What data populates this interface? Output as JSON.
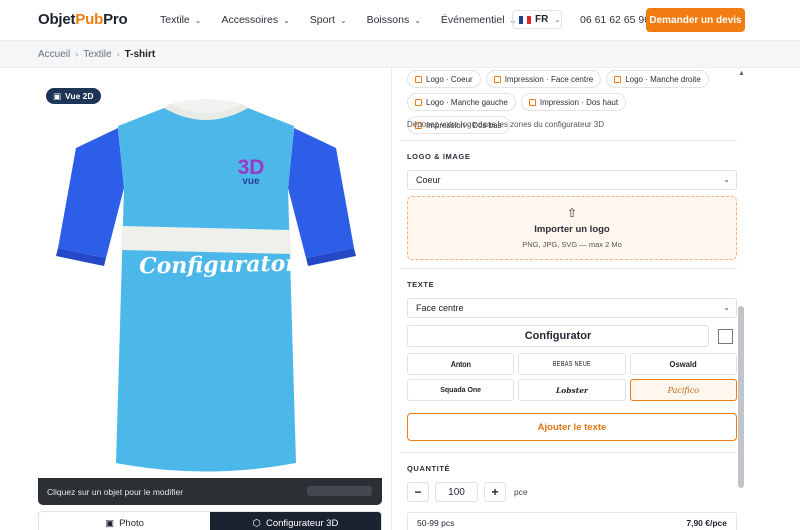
{
  "header": {
    "logo_a": "Objet",
    "logo_b": "Pub",
    "logo_c": "Pro",
    "nav": [
      "Textile",
      "Accessoires",
      "Sport",
      "Boissons",
      "Événementiel"
    ],
    "lang": "FR",
    "phone": "06 61 62 65 90",
    "cta": "Demander un devis"
  },
  "breadcrumb": [
    "Accueil",
    "Textile",
    "T-shirt"
  ],
  "preview": {
    "badge": "Vue 2D",
    "shirt_text": "Configurator",
    "logo_line1": "3D",
    "logo_line2": "vue",
    "hint": "Cliquez sur un objet pour le modifier",
    "tabs": [
      "Photo",
      "Configurateur 3D"
    ],
    "shirt_color": "#4cb8ea",
    "sleeve_color": "#2d5ee8"
  },
  "panel": {
    "zones": [
      "Logo · Coeur",
      "Impression · Face centre",
      "Logo · Manche droite",
      "Logo · Manche gauche",
      "Impression · Dos haut",
      "Impression · Dos bas"
    ],
    "zones_note": "Déposez votre logo dans les zones du configurateur 3D",
    "logo_section": "LOGO & IMAGE",
    "logo_select": "Coeur",
    "upload_title": "Importer un logo",
    "upload_sub": "PNG, JPG, SVG — max 2 Mo",
    "text_section": "TEXTE",
    "text_select": "Face centre",
    "text_value": "Configurator",
    "fonts": [
      "Anton",
      "BEBAS NEUE",
      "Oswald",
      "Squada One",
      "Lobster",
      "Pacifico"
    ],
    "selected_font": "Pacifico",
    "add_text": "Ajouter le texte",
    "qty_section": "QUANTITÉ",
    "qty_value": "100",
    "qty_unit": "pce",
    "price_range": "50-99 pcs",
    "price_value": "7,90 €/pce"
  }
}
